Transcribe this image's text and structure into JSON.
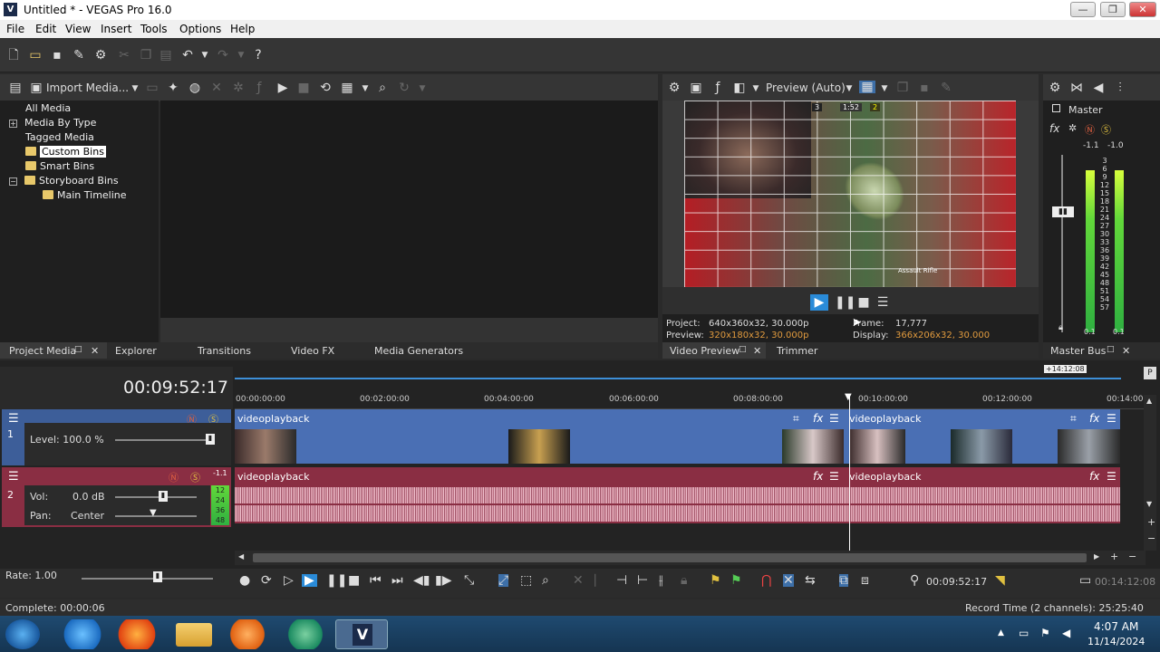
{
  "window": {
    "title": "Untitled * - VEGAS Pro 16.0",
    "logo": "V"
  },
  "menu": [
    "File",
    "Edit",
    "View",
    "Insert",
    "Tools",
    "Options",
    "Help"
  ],
  "project_media": {
    "import_label": "Import Media...",
    "tree": [
      "All Media",
      "Media By Type",
      "Tagged Media",
      "Custom Bins",
      "Smart Bins",
      "Storyboard Bins",
      "Main Timeline"
    ],
    "tabs": [
      "Project Media",
      "Explorer",
      "Transitions",
      "Video FX",
      "Media Generators"
    ]
  },
  "preview": {
    "mode": "Preview (Auto)",
    "project_label": "Project:",
    "project_value": "640x360x32, 30.000p",
    "preview_label": "Preview:",
    "preview_value": "320x180x32, 30.000p",
    "frame_label": "Frame:",
    "frame_value": "17,777",
    "display_label": "Display:",
    "display_value": "366x206x32, 30.000",
    "tabs": [
      "Video Preview",
      "Trimmer"
    ],
    "overlay_text": "Assault Rifle",
    "hud": [
      "3",
      "1:52",
      "2"
    ]
  },
  "master": {
    "label": "Master",
    "peak_left": "-1.1",
    "peak_right": "-1.0",
    "scale": [
      "3",
      "6",
      "9",
      "12",
      "15",
      "18",
      "21",
      "24",
      "27",
      "30",
      "33",
      "36",
      "39",
      "42",
      "45",
      "48",
      "51",
      "54",
      "57"
    ],
    "bottom_left": "0.1",
    "bottom_right": "0.1",
    "tab": "Master Bus"
  },
  "timeline": {
    "timecode": "00:09:52:17",
    "region_end": "+14:12:08",
    "ruler": [
      "00:00:00:00",
      "00:02:00:00",
      "00:04:00:00",
      "00:06:00:00",
      "00:08:00:00",
      "00:10:00:00",
      "00:12:00:00",
      "00:14:00"
    ],
    "track1": {
      "number": "1",
      "level": "Level: 100.0 %",
      "clip": "videoplayback",
      "clip2": "videoplayback"
    },
    "track2": {
      "number": "2",
      "vol_label": "Vol:",
      "vol_value": "0.0 dB",
      "pan_label": "Pan:",
      "pan_value": "Center",
      "peak": "-1.1",
      "meter": [
        "12",
        "24",
        "36",
        "48"
      ],
      "clip": "videoplayback",
      "clip2": "videoplayback"
    },
    "rate": "Rate: 1.00",
    "cursor": "00:09:52:17",
    "end": "00:14:12:08"
  },
  "status": {
    "complete": "Complete: 00:00:06",
    "record": "Record Time (2 channels): 25:25:40"
  },
  "taskbar": {
    "time": "4:07 AM",
    "date": "11/14/2024"
  }
}
